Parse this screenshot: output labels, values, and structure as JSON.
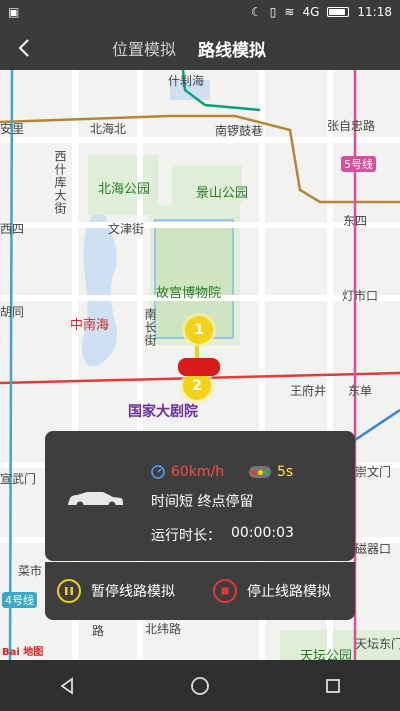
{
  "status": {
    "time": "11:18",
    "network": "4G"
  },
  "header": {
    "tabs": [
      {
        "label": "位置模拟"
      },
      {
        "label": "路线模拟"
      }
    ]
  },
  "map": {
    "labels": {
      "shichahai": "什刹海",
      "anli": "安里",
      "beihaibei": "北海北",
      "nanluoguxiang": "南锣鼓巷",
      "zhangzizhonglu": "张自忠路",
      "line5": "5号线",
      "xishikudajie": "西什库大街",
      "beihaipark": "北海公园",
      "jingshanpark": "景山公园",
      "dongsi": "东四",
      "wenjinjie": "文津街",
      "xisi": "西四",
      "palacemuseum": "故宫博物院",
      "dengshikou": "灯市口",
      "hutong": "胡同",
      "zhongnanhai": "中南海",
      "nanchangjie": "南长街",
      "wangfujing": "王府井",
      "dongdan": "东单",
      "ncpa": "国家大剧院",
      "xuanwumen": "宣武门",
      "chongwenmen": "崇文门",
      "cishikou": "磁器口",
      "caishikou": "菜市",
      "line4": "4号线",
      "lu": "路",
      "beiweilu": "北纬路",
      "tiantanpark": "天坛公园",
      "tiantandongmen": "天坛东门",
      "baidu": "Bai 地图"
    },
    "markers": [
      "1",
      "2"
    ]
  },
  "panel": {
    "speed": "60km/h",
    "light_time": "5s",
    "route_mode": "时间短  终点停留",
    "runtime_label": "运行时长：",
    "runtime_value": "00:00:03"
  },
  "actions": {
    "pause_label": "暂停线路模拟",
    "stop_label": "停止线路模拟"
  },
  "colors": {
    "accent_yellow": "#f3d21a",
    "stop_red": "#e53935",
    "panel": "#3e3e3e"
  }
}
